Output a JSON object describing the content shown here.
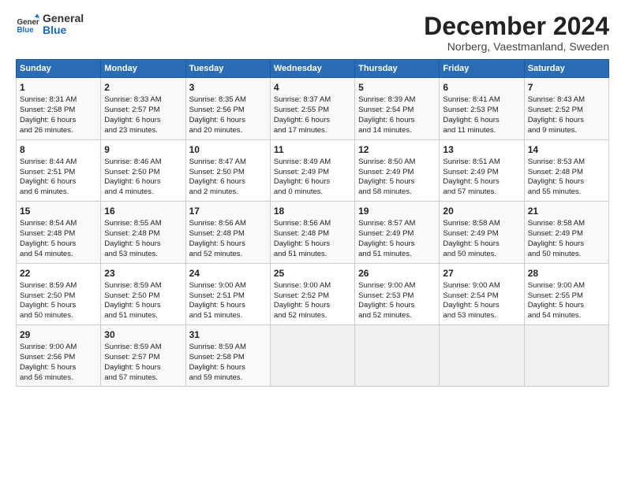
{
  "header": {
    "logo_line1": "General",
    "logo_line2": "Blue",
    "month": "December 2024",
    "location": "Norberg, Vaestmanland, Sweden"
  },
  "days_of_week": [
    "Sunday",
    "Monday",
    "Tuesday",
    "Wednesday",
    "Thursday",
    "Friday",
    "Saturday"
  ],
  "weeks": [
    [
      {
        "day": "1",
        "info": "Sunrise: 8:31 AM\nSunset: 2:58 PM\nDaylight: 6 hours\nand 26 minutes."
      },
      {
        "day": "2",
        "info": "Sunrise: 8:33 AM\nSunset: 2:57 PM\nDaylight: 6 hours\nand 23 minutes."
      },
      {
        "day": "3",
        "info": "Sunrise: 8:35 AM\nSunset: 2:56 PM\nDaylight: 6 hours\nand 20 minutes."
      },
      {
        "day": "4",
        "info": "Sunrise: 8:37 AM\nSunset: 2:55 PM\nDaylight: 6 hours\nand 17 minutes."
      },
      {
        "day": "5",
        "info": "Sunrise: 8:39 AM\nSunset: 2:54 PM\nDaylight: 6 hours\nand 14 minutes."
      },
      {
        "day": "6",
        "info": "Sunrise: 8:41 AM\nSunset: 2:53 PM\nDaylight: 6 hours\nand 11 minutes."
      },
      {
        "day": "7",
        "info": "Sunrise: 8:43 AM\nSunset: 2:52 PM\nDaylight: 6 hours\nand 9 minutes."
      }
    ],
    [
      {
        "day": "8",
        "info": "Sunrise: 8:44 AM\nSunset: 2:51 PM\nDaylight: 6 hours\nand 6 minutes."
      },
      {
        "day": "9",
        "info": "Sunrise: 8:46 AM\nSunset: 2:50 PM\nDaylight: 6 hours\nand 4 minutes."
      },
      {
        "day": "10",
        "info": "Sunrise: 8:47 AM\nSunset: 2:50 PM\nDaylight: 6 hours\nand 2 minutes."
      },
      {
        "day": "11",
        "info": "Sunrise: 8:49 AM\nSunset: 2:49 PM\nDaylight: 6 hours\nand 0 minutes."
      },
      {
        "day": "12",
        "info": "Sunrise: 8:50 AM\nSunset: 2:49 PM\nDaylight: 5 hours\nand 58 minutes."
      },
      {
        "day": "13",
        "info": "Sunrise: 8:51 AM\nSunset: 2:49 PM\nDaylight: 5 hours\nand 57 minutes."
      },
      {
        "day": "14",
        "info": "Sunrise: 8:53 AM\nSunset: 2:48 PM\nDaylight: 5 hours\nand 55 minutes."
      }
    ],
    [
      {
        "day": "15",
        "info": "Sunrise: 8:54 AM\nSunset: 2:48 PM\nDaylight: 5 hours\nand 54 minutes."
      },
      {
        "day": "16",
        "info": "Sunrise: 8:55 AM\nSunset: 2:48 PM\nDaylight: 5 hours\nand 53 minutes."
      },
      {
        "day": "17",
        "info": "Sunrise: 8:56 AM\nSunset: 2:48 PM\nDaylight: 5 hours\nand 52 minutes."
      },
      {
        "day": "18",
        "info": "Sunrise: 8:56 AM\nSunset: 2:48 PM\nDaylight: 5 hours\nand 51 minutes."
      },
      {
        "day": "19",
        "info": "Sunrise: 8:57 AM\nSunset: 2:49 PM\nDaylight: 5 hours\nand 51 minutes."
      },
      {
        "day": "20",
        "info": "Sunrise: 8:58 AM\nSunset: 2:49 PM\nDaylight: 5 hours\nand 50 minutes."
      },
      {
        "day": "21",
        "info": "Sunrise: 8:58 AM\nSunset: 2:49 PM\nDaylight: 5 hours\nand 50 minutes."
      }
    ],
    [
      {
        "day": "22",
        "info": "Sunrise: 8:59 AM\nSunset: 2:50 PM\nDaylight: 5 hours\nand 50 minutes."
      },
      {
        "day": "23",
        "info": "Sunrise: 8:59 AM\nSunset: 2:50 PM\nDaylight: 5 hours\nand 51 minutes."
      },
      {
        "day": "24",
        "info": "Sunrise: 9:00 AM\nSunset: 2:51 PM\nDaylight: 5 hours\nand 51 minutes."
      },
      {
        "day": "25",
        "info": "Sunrise: 9:00 AM\nSunset: 2:52 PM\nDaylight: 5 hours\nand 52 minutes."
      },
      {
        "day": "26",
        "info": "Sunrise: 9:00 AM\nSunset: 2:53 PM\nDaylight: 5 hours\nand 52 minutes."
      },
      {
        "day": "27",
        "info": "Sunrise: 9:00 AM\nSunset: 2:54 PM\nDaylight: 5 hours\nand 53 minutes."
      },
      {
        "day": "28",
        "info": "Sunrise: 9:00 AM\nSunset: 2:55 PM\nDaylight: 5 hours\nand 54 minutes."
      }
    ],
    [
      {
        "day": "29",
        "info": "Sunrise: 9:00 AM\nSunset: 2:56 PM\nDaylight: 5 hours\nand 56 minutes."
      },
      {
        "day": "30",
        "info": "Sunrise: 8:59 AM\nSunset: 2:57 PM\nDaylight: 5 hours\nand 57 minutes."
      },
      {
        "day": "31",
        "info": "Sunrise: 8:59 AM\nSunset: 2:58 PM\nDaylight: 5 hours\nand 59 minutes."
      },
      null,
      null,
      null,
      null
    ]
  ]
}
